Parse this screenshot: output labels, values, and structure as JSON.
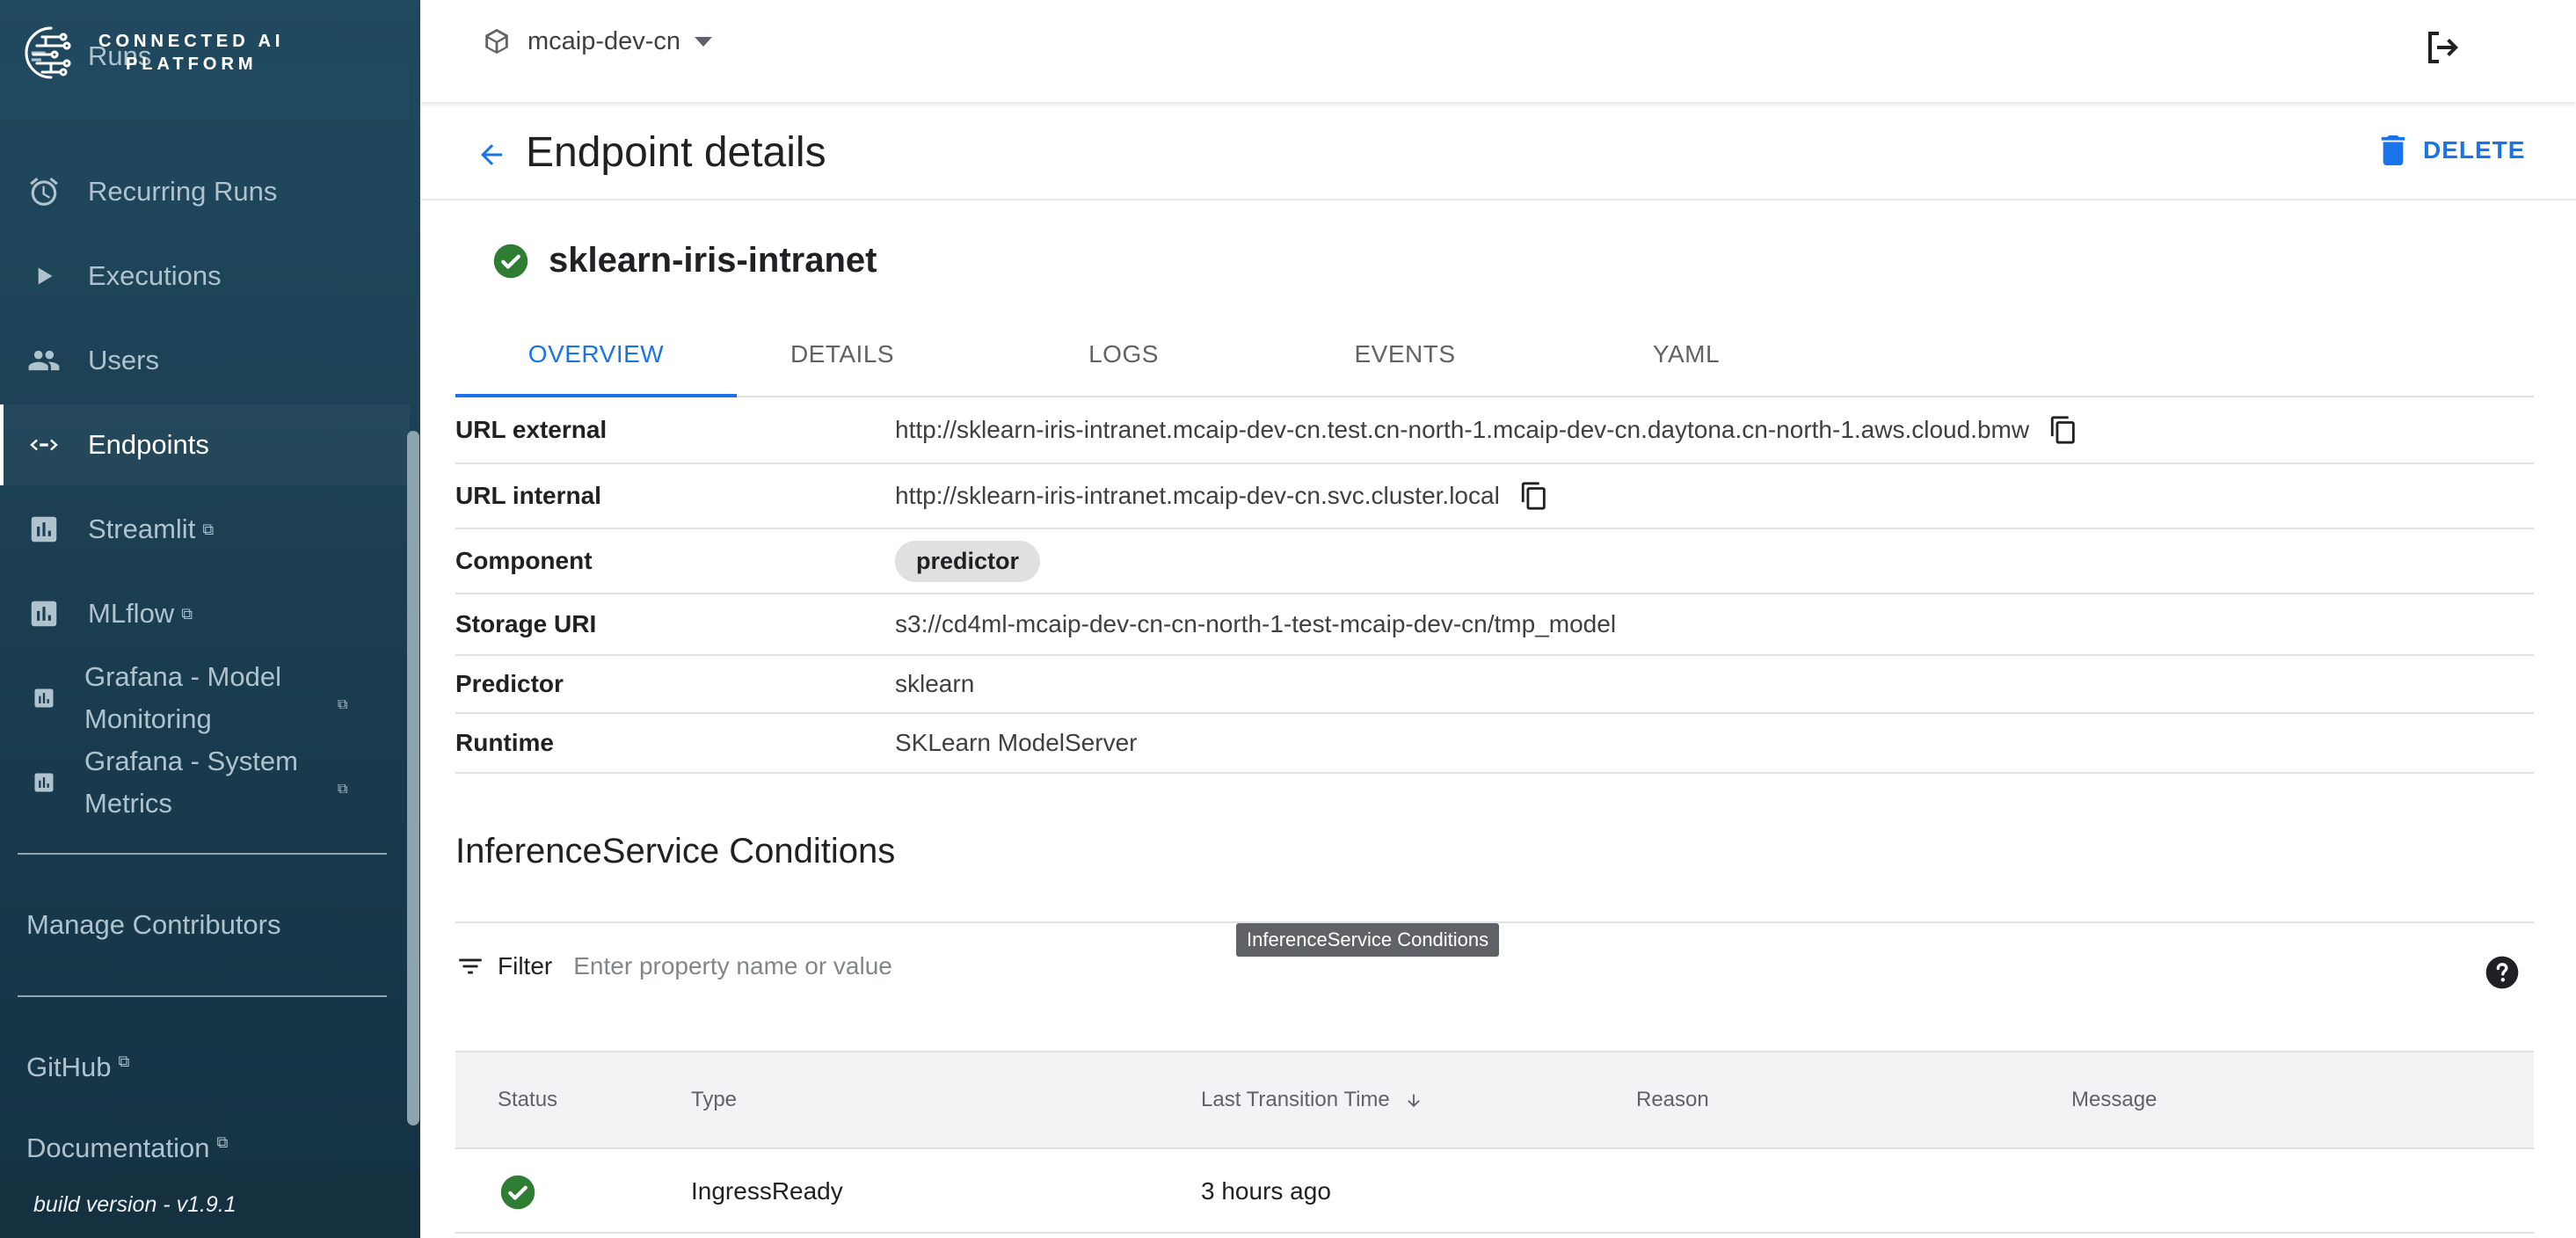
{
  "app": {
    "logo_line1": "CONNECTED AI",
    "logo_line2": "PLATFORM",
    "build_version": "build version - v1.9.1"
  },
  "sidebar": {
    "items": [
      {
        "label": "Runs",
        "icon": "runs-icon"
      },
      {
        "label": "Recurring Runs",
        "icon": "alarm-clock-icon"
      },
      {
        "label": "Executions",
        "icon": "play-icon"
      },
      {
        "label": "Users",
        "icon": "users-icon"
      },
      {
        "label": "Endpoints",
        "icon": "code-arrows-icon",
        "active": true
      },
      {
        "label": "Streamlit",
        "icon": "chart-icon",
        "external": true
      },
      {
        "label": "MLflow",
        "icon": "chart-icon",
        "external": true
      },
      {
        "label_line1": "Grafana - Model",
        "label_line2": "Monitoring",
        "icon": "chart-icon",
        "external": true
      },
      {
        "label_line1": "Grafana - System",
        "label_line2": "Metrics",
        "icon": "chart-icon",
        "external": true
      }
    ],
    "manage_contributors": "Manage Contributors",
    "github": "GitHub",
    "documentation": "Documentation",
    "external_glyph": "⧉"
  },
  "topbar": {
    "namespace": "mcaip-dev-cn"
  },
  "page": {
    "title": "Endpoint details",
    "delete_label": "DELETE",
    "endpoint_name": "sklearn-iris-intranet",
    "tabs": [
      "OVERVIEW",
      "DETAILS",
      "LOGS",
      "EVENTS",
      "YAML"
    ],
    "active_tab": "OVERVIEW"
  },
  "details": {
    "url_external": {
      "key": "URL external",
      "value": "http://sklearn-iris-intranet.mcaip-dev-cn.test.cn-north-1.mcaip-dev-cn.daytona.cn-north-1.aws.cloud.bmw"
    },
    "url_internal": {
      "key": "URL internal",
      "value": "http://sklearn-iris-intranet.mcaip-dev-cn.svc.cluster.local"
    },
    "component": {
      "key": "Component",
      "value": "predictor"
    },
    "storage_uri": {
      "key": "Storage URI",
      "value": "s3://cd4ml-mcaip-dev-cn-cn-north-1-test-mcaip-dev-cn/tmp_model"
    },
    "predictor": {
      "key": "Predictor",
      "value": "sklearn"
    },
    "runtime": {
      "key": "Runtime",
      "value": "SKLearn ModelServer"
    }
  },
  "conditions": {
    "title": "InferenceService Conditions",
    "tooltip": "InferenceService Conditions",
    "filter_label": "Filter",
    "filter_placeholder": "Enter property name or value",
    "columns": [
      "Status",
      "Type",
      "Last Transition Time",
      "Reason",
      "Message"
    ],
    "rows": [
      {
        "status": "ready",
        "type": "IngressReady",
        "last_transition": "3 hours ago",
        "reason": "",
        "message": ""
      }
    ]
  },
  "colors": {
    "accent": "#1a73e8",
    "success": "#2e7d32",
    "sidebar_bg": "#1d4257"
  }
}
